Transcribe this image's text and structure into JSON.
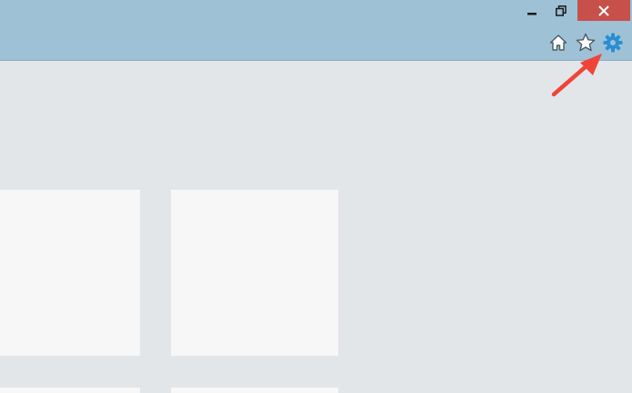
{
  "window": {
    "controls": {
      "minimize_icon": "minimize-icon",
      "restore_icon": "restore-icon",
      "close_icon": "close-icon"
    },
    "toolbar": {
      "home_icon": "home-icon",
      "favorites_icon": "star-icon",
      "tools_icon": "gear-icon"
    },
    "colors": {
      "titlebar": "#9ec1d6",
      "close_button": "#c7504b",
      "content_background": "#e2e6e9",
      "tile_background": "#f7f7f7",
      "tools_icon": "#2a8fd1",
      "annotation": "#f0443a"
    }
  }
}
